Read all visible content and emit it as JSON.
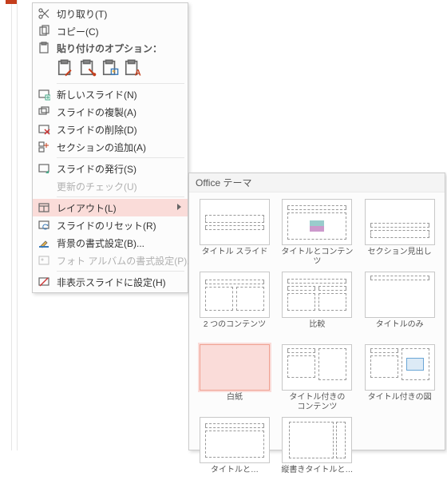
{
  "menu": {
    "cut": "切り取り(T)",
    "copy": "コピー(C)",
    "pasteHeader": "貼り付けのオプション：",
    "newSlide": "新しいスライド(N)",
    "dupSlide": "スライドの複製(A)",
    "delSlide": "スライドの削除(D)",
    "addSection": "セクションの追加(A)",
    "publish": "スライドの発行(S)",
    "checkUpdate": "更新のチェック(U)",
    "layout": "レイアウト(L)",
    "reset": "スライドのリセット(R)",
    "formatBg": "背景の書式設定(B)...",
    "photoAlbum": "フォト アルバムの書式設定(P)...",
    "hideSlide": "非表示スライドに設定(H)"
  },
  "flyout": {
    "title": "Office テーマ",
    "items": [
      "タイトル スライド",
      "タイトルとコンテンツ",
      "セクション見出し",
      "2 つのコンテンツ",
      "比較",
      "タイトルのみ",
      "白紙",
      "タイトル付きの\nコンテンツ",
      "タイトル付きの図",
      "タイトルと…",
      "縦書きタイトルと…"
    ]
  }
}
